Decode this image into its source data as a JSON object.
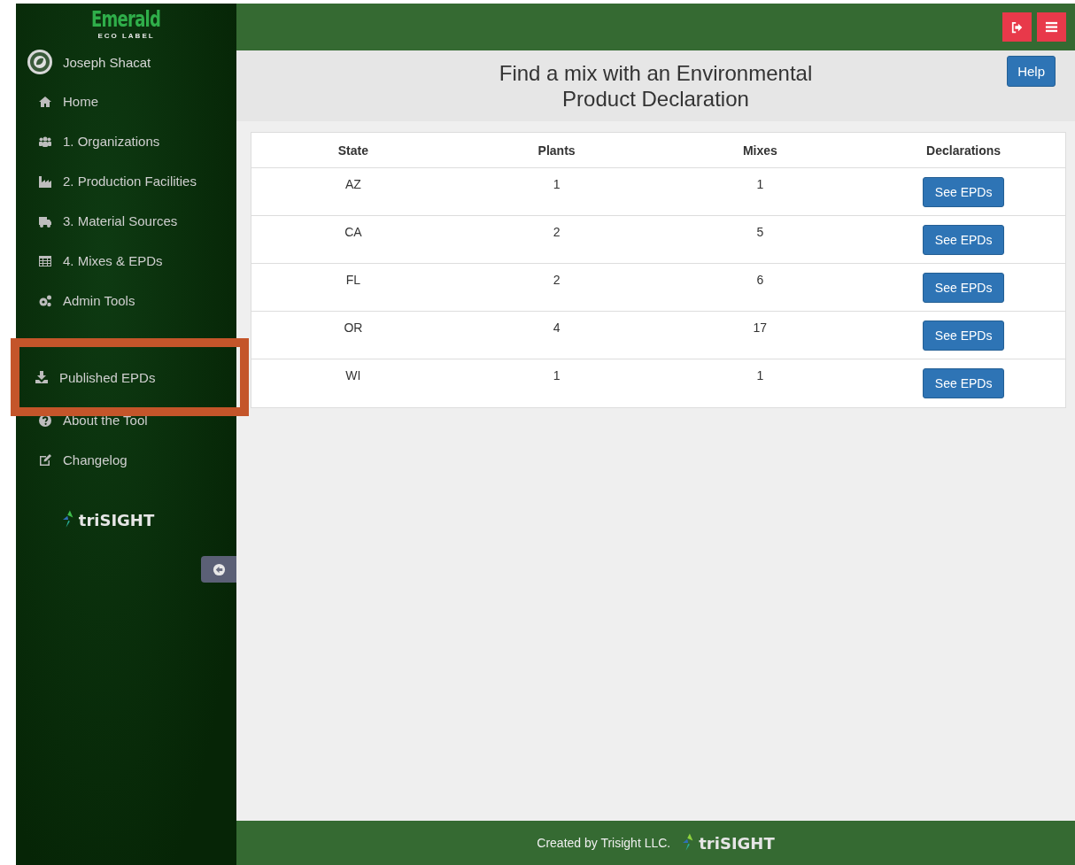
{
  "sidebar": {
    "logo": {
      "name": "Emerald",
      "tagline": "ECO LABEL"
    },
    "user": {
      "name": "Joseph Shacat"
    },
    "items": [
      {
        "label": "Home",
        "highlighted": false
      },
      {
        "label": "1. Organizations",
        "highlighted": false
      },
      {
        "label": "2. Production Facilities",
        "highlighted": false
      },
      {
        "label": "3. Material Sources",
        "highlighted": false
      },
      {
        "label": "4. Mixes & EPDs",
        "highlighted": false
      },
      {
        "label": "Admin Tools",
        "highlighted": false
      },
      {
        "label": "Published EPDs",
        "highlighted": true
      },
      {
        "label": "About the Tool",
        "highlighted": false
      },
      {
        "label": "Changelog",
        "highlighted": false
      }
    ],
    "brand": "triSIGHT"
  },
  "page": {
    "title": "Find a mix with an Environmental Product Declaration",
    "help_button": "Help"
  },
  "table": {
    "columns": [
      "State",
      "Plants",
      "Mixes",
      "Declarations"
    ],
    "rows": [
      {
        "state": "AZ",
        "plants": "1",
        "mixes": "1",
        "action": "See EPDs"
      },
      {
        "state": "CA",
        "plants": "2",
        "mixes": "5",
        "action": "See EPDs"
      },
      {
        "state": "FL",
        "plants": "2",
        "mixes": "6",
        "action": "See EPDs"
      },
      {
        "state": "OR",
        "plants": "4",
        "mixes": "17",
        "action": "See EPDs"
      },
      {
        "state": "WI",
        "plants": "1",
        "mixes": "1",
        "action": "See EPDs"
      }
    ]
  },
  "footer": {
    "text": "Created by Trisight LLC.",
    "brand": "triSIGHT"
  }
}
